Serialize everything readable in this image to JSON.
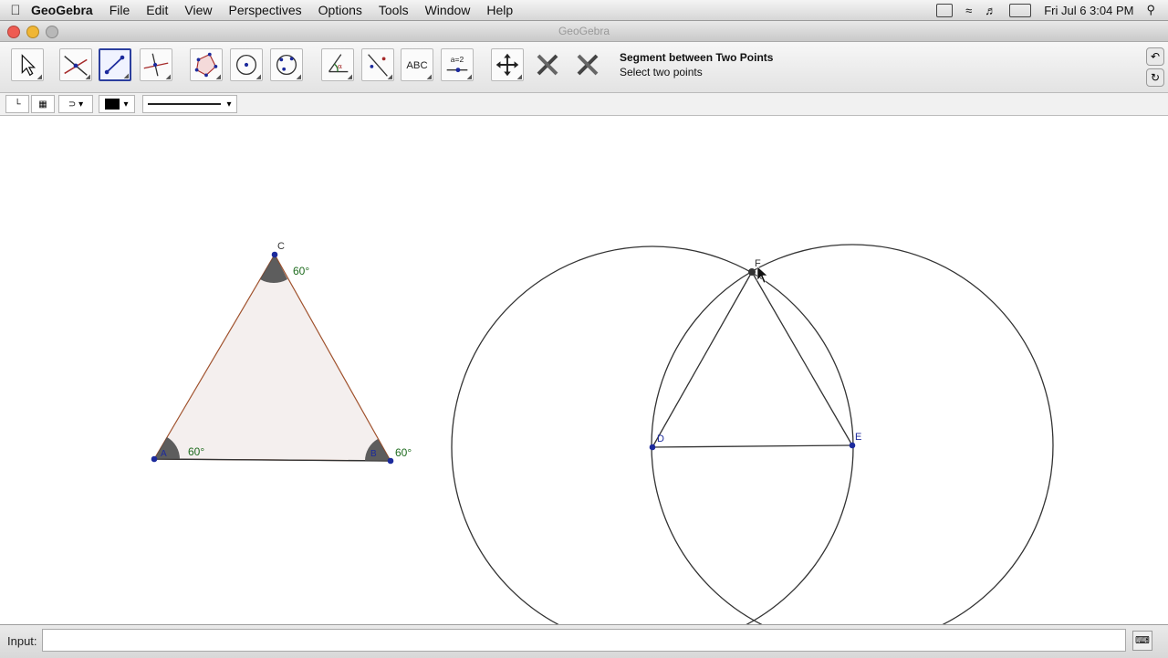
{
  "menubar": {
    "app_name": "GeoGebra",
    "items": [
      "File",
      "Edit",
      "View",
      "Perspectives",
      "Options",
      "Tools",
      "Window",
      "Help"
    ],
    "clock": "Fri Jul 6  3:04 PM"
  },
  "window": {
    "title": "GeoGebra"
  },
  "toolbar": {
    "selected_tool": "segment-between-two-points",
    "polygon_icon_label": "ABC",
    "slider_icon_label": "a=2",
    "tool_name": "Segment between Two Points",
    "tool_help": "Select two points"
  },
  "input_bar": {
    "label": "Input:",
    "value": ""
  },
  "construction": {
    "triangle_labels": [
      "A",
      "B",
      "C"
    ],
    "triangle_angle_text": [
      "60°",
      "60°",
      "60°"
    ],
    "circle_points": [
      "D",
      "E",
      "F"
    ]
  },
  "colors": {
    "point_blue": "#1c2a9c",
    "triangle_fill": "#f4efee",
    "triangle_edge": "#a0522d",
    "angle_fill": "#4d4d4d",
    "angle_text": "#1e6b1e"
  }
}
